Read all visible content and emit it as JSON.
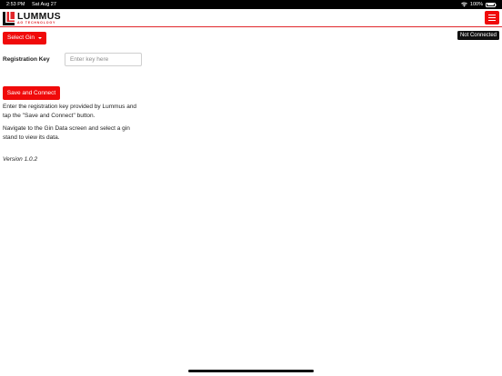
{
  "status_bar": {
    "time": "2:53 PM",
    "date": "Sat Aug 27",
    "battery": "100%",
    "icons": [
      "wifi-icon",
      "battery-icon"
    ]
  },
  "header": {
    "logo_title": "LUMMUS",
    "logo_subtitle": "AG TECHNOLOGY",
    "menu_icon": "hamburger-menu-icon"
  },
  "toolbar": {
    "select_gin_label": "Select Gin",
    "connection_status": "Not Connected"
  },
  "registration": {
    "label": "Registration Key",
    "value": "",
    "placeholder": "Enter key here",
    "save_label": "Save and Connect"
  },
  "instructions": [
    "Enter the registration key provided by Lummus and tap the \"Save and Connect\" button.",
    "Navigate to the Gin Data screen and select a gin stand to view its data."
  ],
  "version": "Version 1.0.2",
  "colors": {
    "accent": "#f00a0a",
    "badge_bg": "#111111",
    "header_rule": "#e0262b"
  }
}
